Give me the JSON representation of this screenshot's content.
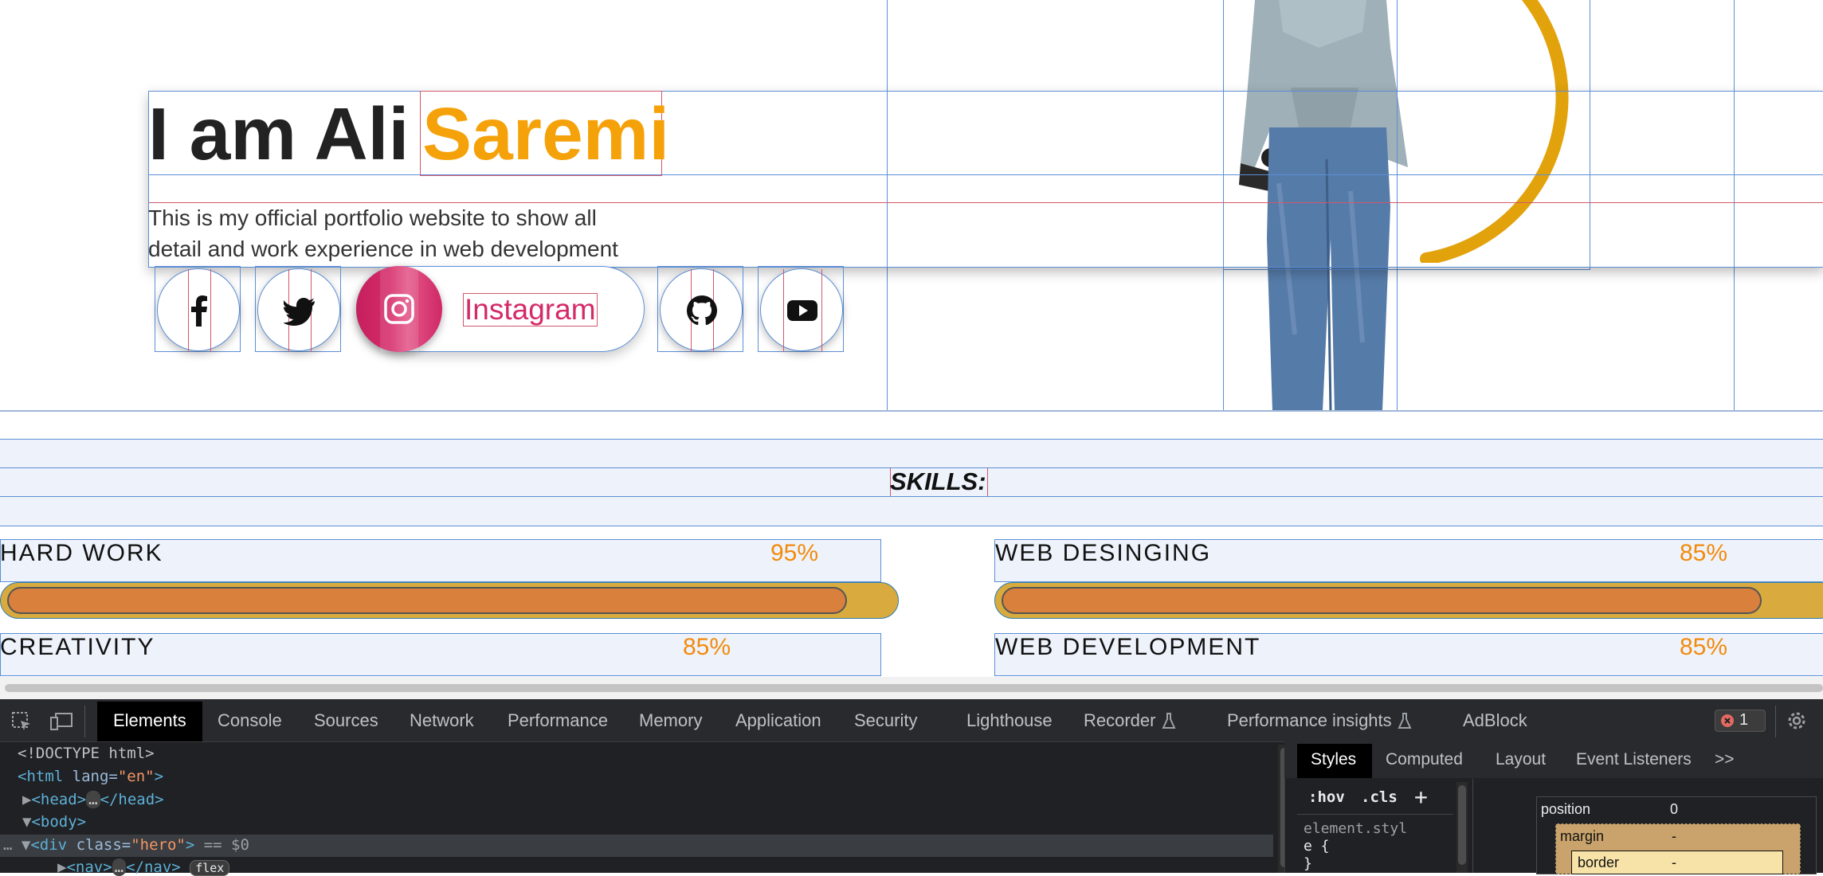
{
  "hero": {
    "title_prefix": "I am Ali",
    "title_accent": "Saremi",
    "subtitle_line1": "This is my official portfolio website to show all",
    "subtitle_line2": "detail and work experience in web development",
    "instagram_label": "Instagram",
    "socials": [
      "facebook-icon",
      "twitter-icon",
      "instagram-icon",
      "github-icon",
      "youtube-icon"
    ]
  },
  "skills": {
    "title": "SKILLS:",
    "items": [
      {
        "name": "HARD WORK",
        "percent": "95%",
        "level": 0.95
      },
      {
        "name": "WEB DESINGING",
        "percent": "85%",
        "level": 0.85
      },
      {
        "name": "CREATIVITY",
        "percent": "85%"
      },
      {
        "name": "WEB DEVELOPMENT",
        "percent": "85%"
      }
    ]
  },
  "colors": {
    "accent": "#f5a20a",
    "instagram": "#d42a68",
    "bar_track": "#d9ab3e",
    "bar_fill": "#d8803c"
  },
  "devtools": {
    "tabs": [
      "Elements",
      "Console",
      "Sources",
      "Network",
      "Performance",
      "Memory",
      "Application",
      "Security",
      "Lighthouse",
      "Recorder",
      "Performance insights",
      "AdBlock"
    ],
    "active_tab": "Elements",
    "error_count": "1",
    "dom_lines": {
      "doctype": "<!DOCTYPE html>",
      "html_open": "<html",
      "html_attr": " lang=",
      "html_val": "\"en\"",
      "html_close": ">",
      "head": "<head>",
      "head_ellipsis": "…",
      "head_close": "</head>",
      "body": "<body>",
      "div_open": "<div",
      "div_attr": " class=",
      "div_val": "\"hero\"",
      "div_close": ">",
      "div_suffix": " == $0",
      "nav": "<nav>",
      "nav_ellipsis": "…",
      "nav_close": "</nav>",
      "nav_badge": "flex"
    },
    "side_tabs": [
      "Styles",
      "Computed",
      "Layout",
      "Event Listeners"
    ],
    "side_more": ">>",
    "hov": ":hov",
    "cls": ".cls",
    "plus": "+",
    "element_style_1": "element.styl",
    "element_style_2": "e {",
    "element_style_3": "}",
    "box_model": {
      "position_label": "position",
      "position_value": "0",
      "margin_label": "margin",
      "margin_value": "-",
      "border_label": "border",
      "border_value": "-"
    }
  }
}
